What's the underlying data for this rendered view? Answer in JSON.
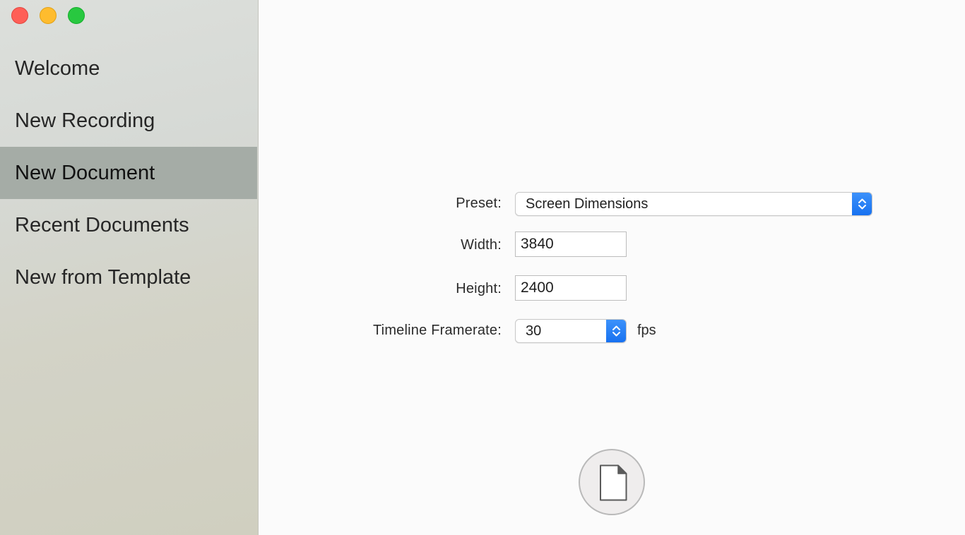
{
  "sidebar": {
    "items": [
      {
        "label": "Welcome"
      },
      {
        "label": "New Recording"
      },
      {
        "label": "New Document"
      },
      {
        "label": "Recent Documents"
      },
      {
        "label": "New from Template"
      }
    ],
    "selected": "New Document"
  },
  "form": {
    "preset_label": "Preset:",
    "preset_value": "Screen Dimensions",
    "width_label": "Width:",
    "width_value": "3840",
    "height_label": "Height:",
    "height_value": "2400",
    "framerate_label": "Timeline Framerate:",
    "framerate_value": "30",
    "framerate_unit": "fps"
  },
  "icons": {
    "close": "close-button",
    "minimize": "minimize-button",
    "maximize": "maximize-button",
    "popup_stepper": "chevron-up-down-icon",
    "create": "document-icon"
  },
  "colors": {
    "selected_row": "#a5aca6",
    "accent": "#1670f0",
    "close": "#fe5f57",
    "minimize": "#febc2e",
    "maximize": "#28c840"
  }
}
